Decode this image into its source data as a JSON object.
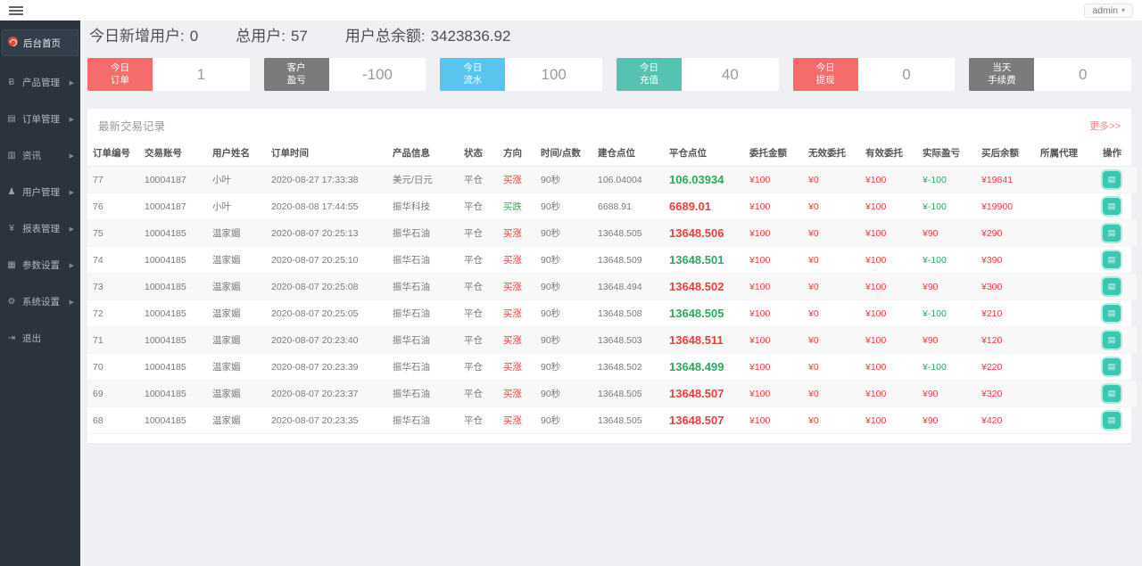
{
  "topbar": {
    "user_menu_label": "admin",
    "caret": "▾"
  },
  "sidebar": {
    "items": [
      {
        "key": "home",
        "label": "后台首页",
        "icon": "dashboard-icon",
        "active": true,
        "expandable": false
      },
      {
        "key": "products",
        "label": "产品管理",
        "icon": "product-icon",
        "active": false,
        "expandable": true
      },
      {
        "key": "orders",
        "label": "订单管理",
        "icon": "orders-icon",
        "active": false,
        "expandable": true
      },
      {
        "key": "news",
        "label": "资讯",
        "icon": "news-icon",
        "active": false,
        "expandable": true
      },
      {
        "key": "users",
        "label": "用户管理",
        "icon": "users-icon",
        "active": false,
        "expandable": true
      },
      {
        "key": "reports",
        "label": "报表管理",
        "icon": "reports-icon",
        "active": false,
        "expandable": true
      },
      {
        "key": "params",
        "label": "参数设置",
        "icon": "params-icon",
        "active": false,
        "expandable": true
      },
      {
        "key": "system",
        "label": "系统设置",
        "icon": "system-icon",
        "active": false,
        "expandable": true
      },
      {
        "key": "logout",
        "label": "退出",
        "icon": "logout-icon",
        "active": false,
        "expandable": false
      }
    ]
  },
  "stats": [
    {
      "label": "今日新增用户:",
      "value": "0"
    },
    {
      "label": "总用户:",
      "value": "57"
    },
    {
      "label": "用户总余额:",
      "value": "3423836.92"
    }
  ],
  "cards": [
    {
      "key": "today-orders",
      "lines": [
        "今日",
        "订单"
      ],
      "value": "1",
      "color": "#f56c6c"
    },
    {
      "key": "customer-pnl",
      "lines": [
        "客户",
        "盈亏"
      ],
      "value": "-100",
      "color": "#7b7b7b"
    },
    {
      "key": "today-flow",
      "lines": [
        "今日",
        "流水"
      ],
      "value": "100",
      "color": "#59c4ee"
    },
    {
      "key": "today-deposit",
      "lines": [
        "今日",
        "充值"
      ],
      "value": "40",
      "color": "#56c2b1"
    },
    {
      "key": "today-withdraw",
      "lines": [
        "今日",
        "提现"
      ],
      "value": "0",
      "color": "#f56c6c"
    },
    {
      "key": "today-fee",
      "lines": [
        "当天",
        "手续费"
      ],
      "value": "0",
      "color": "#7b7b7b"
    }
  ],
  "table": {
    "title": "最新交易记录",
    "more_link": "更多>>",
    "columns": [
      "订单编号",
      "交易账号",
      "用户姓名",
      "订单时间",
      "产品信息",
      "状态",
      "方向",
      "时间/点数",
      "建仓点位",
      "平仓点位",
      "委托金额",
      "无效委托",
      "有效委托",
      "实际盈亏",
      "买后余额",
      "所属代理",
      "操作"
    ],
    "op_icon": "order-detail-icon",
    "rows": [
      {
        "id": "77",
        "account": "10004187",
        "name": "小叶",
        "time": "2020-08-27 17:33:38",
        "product": "美元/日元",
        "status": "平仓",
        "direction": "买涨",
        "direction_color": "red",
        "duration": "90秒",
        "open": "106.04004",
        "close": "106.03934",
        "close_color": "green",
        "amount": "¥100",
        "invalid": "¥0",
        "valid": "¥100",
        "profit": "¥-100",
        "profit_color": "green",
        "balance": "¥19841",
        "agent": ""
      },
      {
        "id": "76",
        "account": "10004187",
        "name": "小叶",
        "time": "2020-08-08 17:44:55",
        "product": "振华科技",
        "status": "平仓",
        "direction": "买跌",
        "direction_color": "green",
        "duration": "90秒",
        "open": "6688.91",
        "close": "6689.01",
        "close_color": "red",
        "amount": "¥100",
        "invalid": "¥0",
        "valid": "¥100",
        "profit": "¥-100",
        "profit_color": "green",
        "balance": "¥19900",
        "agent": ""
      },
      {
        "id": "75",
        "account": "10004185",
        "name": "温家媚",
        "time": "2020-08-07 20:25:13",
        "product": "振华石油",
        "status": "平仓",
        "direction": "买涨",
        "direction_color": "red",
        "duration": "90秒",
        "open": "13648.505",
        "close": "13648.506",
        "close_color": "red",
        "amount": "¥100",
        "invalid": "¥0",
        "valid": "¥100",
        "profit": "¥90",
        "profit_color": "red",
        "balance": "¥290",
        "agent": ""
      },
      {
        "id": "74",
        "account": "10004185",
        "name": "温家媚",
        "time": "2020-08-07 20:25:10",
        "product": "振华石油",
        "status": "平仓",
        "direction": "买涨",
        "direction_color": "red",
        "duration": "90秒",
        "open": "13648.509",
        "close": "13648.501",
        "close_color": "green",
        "amount": "¥100",
        "invalid": "¥0",
        "valid": "¥100",
        "profit": "¥-100",
        "profit_color": "green",
        "balance": "¥390",
        "agent": ""
      },
      {
        "id": "73",
        "account": "10004185",
        "name": "温家媚",
        "time": "2020-08-07 20:25:08",
        "product": "振华石油",
        "status": "平仓",
        "direction": "买涨",
        "direction_color": "red",
        "duration": "90秒",
        "open": "13648.494",
        "close": "13648.502",
        "close_color": "red",
        "amount": "¥100",
        "invalid": "¥0",
        "valid": "¥100",
        "profit": "¥90",
        "profit_color": "red",
        "balance": "¥300",
        "agent": ""
      },
      {
        "id": "72",
        "account": "10004185",
        "name": "温家媚",
        "time": "2020-08-07 20:25:05",
        "product": "振华石油",
        "status": "平仓",
        "direction": "买涨",
        "direction_color": "red",
        "duration": "90秒",
        "open": "13648.508",
        "close": "13648.505",
        "close_color": "green",
        "amount": "¥100",
        "invalid": "¥0",
        "valid": "¥100",
        "profit": "¥-100",
        "profit_color": "green",
        "balance": "¥210",
        "agent": ""
      },
      {
        "id": "71",
        "account": "10004185",
        "name": "温家媚",
        "time": "2020-08-07 20:23:40",
        "product": "振华石油",
        "status": "平仓",
        "direction": "买涨",
        "direction_color": "red",
        "duration": "90秒",
        "open": "13648.503",
        "close": "13648.511",
        "close_color": "red",
        "amount": "¥100",
        "invalid": "¥0",
        "valid": "¥100",
        "profit": "¥90",
        "profit_color": "red",
        "balance": "¥120",
        "agent": ""
      },
      {
        "id": "70",
        "account": "10004185",
        "name": "温家媚",
        "time": "2020-08-07 20:23:39",
        "product": "振华石油",
        "status": "平仓",
        "direction": "买涨",
        "direction_color": "red",
        "duration": "90秒",
        "open": "13648.502",
        "close": "13648.499",
        "close_color": "green",
        "amount": "¥100",
        "invalid": "¥0",
        "valid": "¥100",
        "profit": "¥-100",
        "profit_color": "green",
        "balance": "¥220",
        "agent": ""
      },
      {
        "id": "69",
        "account": "10004185",
        "name": "温家媚",
        "time": "2020-08-07 20:23:37",
        "product": "振华石油",
        "status": "平仓",
        "direction": "买涨",
        "direction_color": "red",
        "duration": "90秒",
        "open": "13648.505",
        "close": "13648.507",
        "close_color": "red",
        "amount": "¥100",
        "invalid": "¥0",
        "valid": "¥100",
        "profit": "¥90",
        "profit_color": "red",
        "balance": "¥320",
        "agent": ""
      },
      {
        "id": "68",
        "account": "10004185",
        "name": "温家媚",
        "time": "2020-08-07 20:23:35",
        "product": "振华石油",
        "status": "平仓",
        "direction": "买涨",
        "direction_color": "red",
        "duration": "90秒",
        "open": "13648.505",
        "close": "13648.507",
        "close_color": "red",
        "amount": "¥100",
        "invalid": "¥0",
        "valid": "¥100",
        "profit": "¥90",
        "profit_color": "red",
        "balance": "¥420",
        "agent": ""
      }
    ]
  },
  "colors": {
    "red": "#f23b3b",
    "green": "#2ea95f",
    "accent_teal": "#3dc7b3"
  }
}
